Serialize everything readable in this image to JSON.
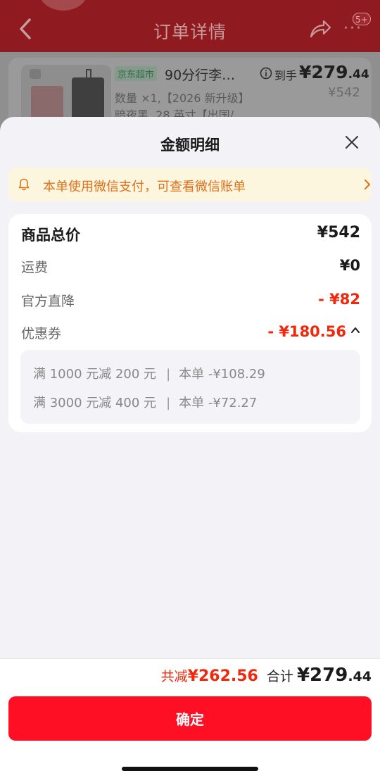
{
  "background_page": {
    "header": {
      "title": "订单详情",
      "notification_badge": "5+",
      "more_icon": "more-dots-icon",
      "share_icon": "share-icon",
      "back_icon": "back-chevron-icon"
    },
    "product": {
      "store_tag": "京东超市",
      "name": "90分行李…",
      "arrival_label": "到手",
      "price_int": "¥279",
      "price_dec": ".44",
      "original_price": "¥542",
      "spec_line1": "数量 ×1,【2026 新升级】",
      "spec_line2": "暗夜黑, 28 英寸【出国/"
    }
  },
  "sheet": {
    "title": "金额明细",
    "notice": {
      "text": "本单使用微信支付，可查看微信账单",
      "icon": "bell-icon",
      "arrow_icon": "chevron-right-icon"
    },
    "rows": [
      {
        "label": "商品总价",
        "value": "¥542"
      },
      {
        "label": "运费",
        "value": "¥0"
      },
      {
        "label": "官方直降",
        "value": "- ¥82"
      },
      {
        "label": "优惠券",
        "value": "- ¥180.56"
      }
    ],
    "coupons": [
      {
        "rule": "满 1000 元减 200 元",
        "sep": "|",
        "applied": "本单 -¥108.29"
      },
      {
        "rule": "满 3000 元减 400 元",
        "sep": "|",
        "applied": "本单 -¥72.27"
      }
    ]
  },
  "footer": {
    "saved_label": "共减",
    "saved_amount": "¥262.56",
    "total_label": "合计",
    "total_int": "¥279",
    "total_dec": ".44",
    "confirm_label": "确定"
  },
  "colors": {
    "accent_red": "#ff0f23",
    "discount_red": "#f2270c",
    "notice_bg": "#fdf6df",
    "notice_text": "#e0701a"
  }
}
